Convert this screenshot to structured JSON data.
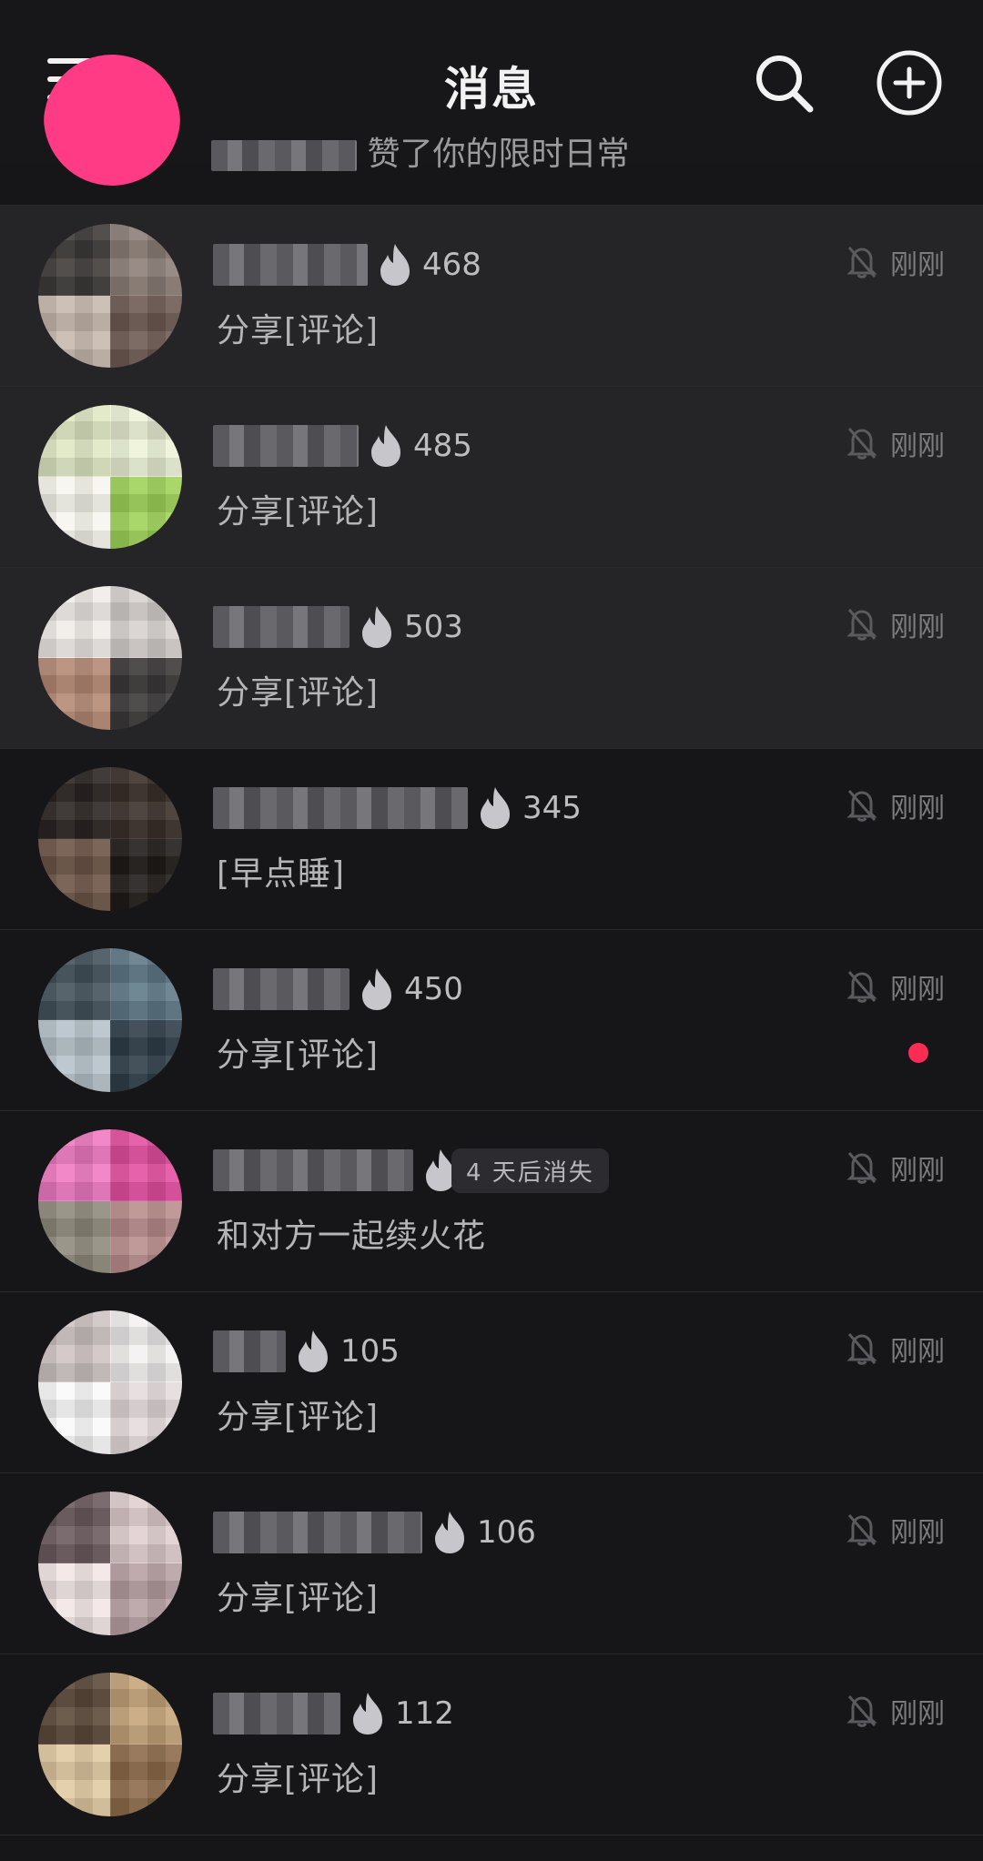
{
  "header": {
    "title": "消息"
  },
  "notification": {
    "text": "赞了你的限时日常"
  },
  "conversations": [
    {
      "streak": "468",
      "preview": "分享[评论]",
      "time": "刚刚",
      "highlight": true,
      "name_w": 170,
      "avatar_colors": [
        "#8d7f78",
        "#6e5a52",
        "#c7b8ae",
        "#3d3a38"
      ]
    },
    {
      "streak": "485",
      "preview": "分享[评论]",
      "time": "刚刚",
      "highlight": true,
      "name_w": 160,
      "avatar_colors": [
        "#eef3d8",
        "#9fd35a",
        "#f7f6ee",
        "#dfe8c4"
      ]
    },
    {
      "streak": "503",
      "preview": "分享[评论]",
      "time": "刚刚",
      "highlight": true,
      "name_w": 150,
      "avatar_colors": [
        "#d7d2cf",
        "#3b3838",
        "#b58974",
        "#f0ece8"
      ]
    },
    {
      "streak": "345",
      "preview": "[早点睡]",
      "time": "刚刚",
      "highlight": false,
      "name_w": 280,
      "avatar_colors": [
        "#3a302b",
        "#1f1b19",
        "#6d5447",
        "#2a2523"
      ]
    },
    {
      "streak": "450",
      "preview": "分享[评论]",
      "time": "刚刚",
      "highlight": false,
      "name_w": 150,
      "avatar_colors": [
        "#5f7987",
        "#2f3e49",
        "#b6c2ca",
        "#44525b"
      ],
      "unread": true
    },
    {
      "streak": "",
      "chip": "4 天后消失",
      "preview": "和对方一起续火花",
      "time": "刚刚",
      "highlight": false,
      "name_w": 220,
      "avatar_colors": [
        "#e44fa0",
        "#b98d8d",
        "#8f8a7c",
        "#f07ac2"
      ]
    },
    {
      "streak": "105",
      "preview": "分享[评论]",
      "time": "刚刚",
      "highlight": false,
      "name_w": 80,
      "avatar_colors": [
        "#f3f0f0",
        "#e6dcdc",
        "#fafafa",
        "#cfc4c4"
      ]
    },
    {
      "streak": "106",
      "preview": "分享[评论]",
      "time": "刚刚",
      "highlight": false,
      "name_w": 230,
      "avatar_colors": [
        "#e1cfd0",
        "#b7a0a3",
        "#f2e6e6",
        "#6b5b5e"
      ]
    },
    {
      "streak": "112",
      "preview": "分享[评论]",
      "time": "刚刚",
      "highlight": false,
      "name_w": 140,
      "avatar_colors": [
        "#c6a57b",
        "#8e6b4b",
        "#e2caa2",
        "#5b4a3a"
      ]
    }
  ]
}
